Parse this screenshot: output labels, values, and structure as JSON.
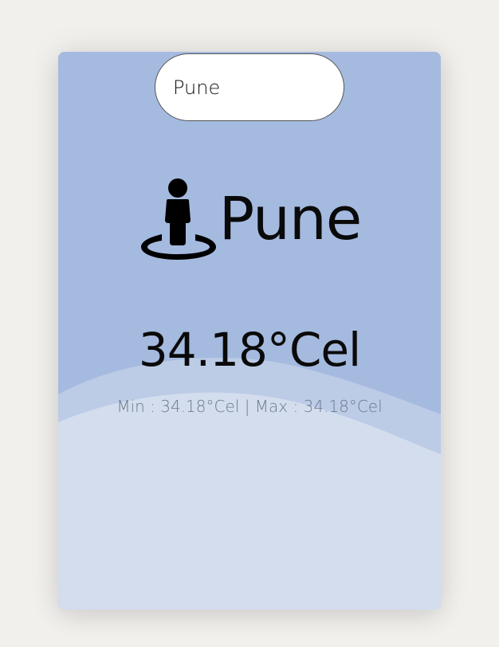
{
  "search": {
    "value": "Pune",
    "placeholder": ""
  },
  "location": {
    "icon": "street-view-icon",
    "city": "Pune"
  },
  "weather": {
    "temperature": "34.18°Cel",
    "min_label": "Min",
    "min_value": "34.18°Cel",
    "separator": "|",
    "max_label": "Max",
    "max_value": "34.18°Cel",
    "minmax_text": "Min : 34.18°Cel | Max : 34.18°Cel"
  },
  "colors": {
    "page_background": "#f1f0ed",
    "card_top": "#a5badf",
    "wave_middle": "#bccbe6",
    "wave_front": "#d3ddee",
    "text_primary": "#0a0a0a",
    "text_secondary": "#6e7a8c"
  }
}
